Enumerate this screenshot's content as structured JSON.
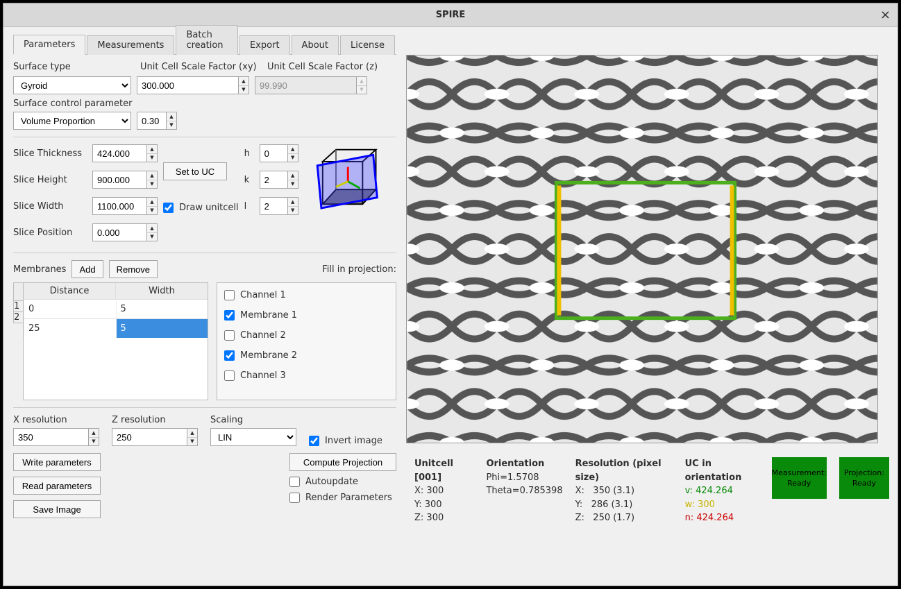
{
  "window": {
    "title": "SPIRE",
    "close": "×"
  },
  "tabs": [
    "Parameters",
    "Measurements",
    "Batch creation",
    "Export",
    "About",
    "License"
  ],
  "activeTab": 0,
  "surface": {
    "type_label": "Surface type",
    "type_value": "Gyroid",
    "xy_label": "Unit Cell Scale Factor (xy)",
    "xy_value": "300.000",
    "z_label": "Unit Cell Scale Factor  (z)",
    "z_value": "99.990",
    "ctrl_label": "Surface control parameter",
    "ctrl_value": "Volume Proportion",
    "ctrl_num": "0.30"
  },
  "slice": {
    "thickness_label": "Slice Thickness",
    "thickness": "424.000",
    "height_label": "Slice Height",
    "height": "900.000",
    "width_label": "Slice Width",
    "width": "1100.000",
    "position_label": "Slice Position",
    "position": "0.000",
    "set_uc": "Set to UC",
    "draw_uc_label": "Draw unitcell",
    "draw_uc": true,
    "h_label": "h",
    "h": "0",
    "k_label": "k",
    "k": "2",
    "l_label": "l",
    "l": "2"
  },
  "membranes": {
    "label": "Membranes",
    "add": "Add",
    "remove": "Remove",
    "fill_label": "Fill in projection:",
    "cols": [
      "Distance",
      "Width"
    ],
    "rows": [
      {
        "n": "1",
        "distance": "0",
        "width": "5",
        "selCol": -1
      },
      {
        "n": "2",
        "distance": "25",
        "width": "5",
        "selCol": 1
      }
    ],
    "channels": [
      {
        "label": "Channel 1",
        "checked": false
      },
      {
        "label": "Membrane 1",
        "checked": true
      },
      {
        "label": "Channel 2",
        "checked": false
      },
      {
        "label": "Membrane 2",
        "checked": true
      },
      {
        "label": "Channel 3",
        "checked": false
      }
    ]
  },
  "resolution": {
    "x_label": "X resolution",
    "x": "350",
    "z_label": "Z resolution",
    "z": "250",
    "scaling_label": "Scaling",
    "scaling": "LIN",
    "invert_label": "Invert image",
    "invert": true
  },
  "buttons": {
    "write": "Write parameters",
    "read": "Read parameters",
    "save": "Save Image",
    "compute": "Compute Projection",
    "autoupdate_label": "Autoupdate",
    "autoupdate": false,
    "render_label": "Render Parameters",
    "render": false
  },
  "info": {
    "uc_head": "Unitcell [001]",
    "uc_x": "X: 300",
    "uc_y": "Y: 300",
    "uc_z": "Z: 300",
    "orient_head": "Orientation",
    "phi": "Phi=1.5708",
    "theta": "Theta=0.785398",
    "res_head": "Resolution (pixel size)",
    "res_x": "X:   350 (3.1)",
    "res_y": "Y:   286 (3.1)",
    "res_z": "Z:   250 (1.7)",
    "uco_head": "UC in orientation",
    "v": "v: 424.264",
    "w": "w: 300",
    "n": "n: 424.264",
    "meas": "Measurement:",
    "proj": "Projection:",
    "ready": "Ready"
  }
}
